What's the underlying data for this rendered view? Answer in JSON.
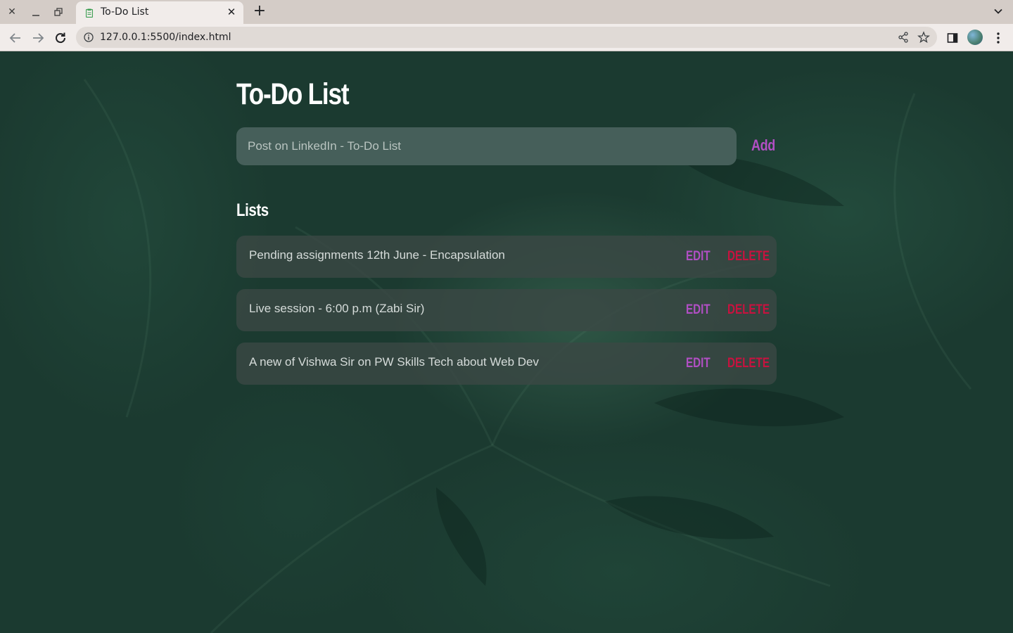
{
  "browser": {
    "tab": {
      "title": "To-Do List",
      "favicon": "clipboard-icon",
      "favicon_color": "#3f9f54"
    },
    "url": "127.0.0.1:5500/index.html"
  },
  "app": {
    "title": "To-Do List",
    "input": {
      "value": "Post on LinkedIn - To-Do List",
      "placeholder": ""
    },
    "add_label": "Add",
    "lists_heading": "Lists",
    "tasks": [
      {
        "text": "Pending assignments 12th June - Encapsulation",
        "edit_label": "EDIT",
        "delete_label": "DELETE"
      },
      {
        "text": "Live session - 6:00 p.m (Zabi Sir)",
        "edit_label": "EDIT",
        "delete_label": "DELETE"
      },
      {
        "text": "A new of Vishwa Sir on PW Skills Tech about Web Dev",
        "edit_label": "EDIT",
        "delete_label": "DELETE"
      }
    ]
  },
  "colors": {
    "accent": "#b14fc4",
    "danger": "#c8123f",
    "background": "#1b3a30",
    "input_bg": "#465f5a",
    "item_bg": "#3a4844"
  }
}
